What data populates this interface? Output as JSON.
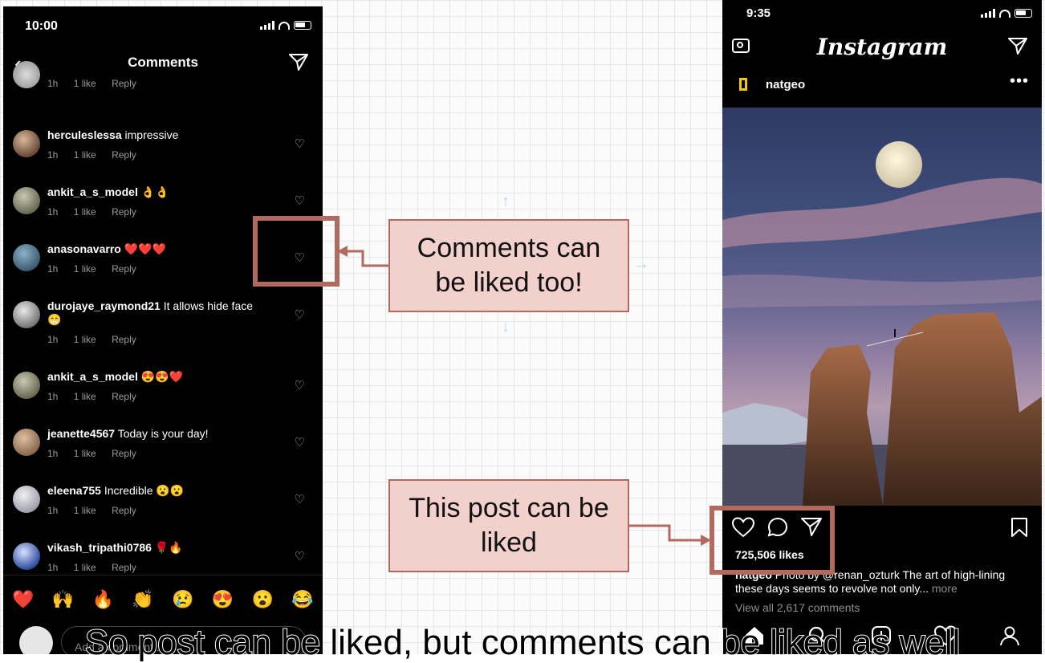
{
  "left_phone": {
    "status_time": "10:00",
    "nav_title": "Comments",
    "first_row_meta": {
      "time": "1h",
      "likes": "1 like",
      "reply": "Reply"
    },
    "comments": [
      {
        "user": "herculeslessa",
        "text": " impressive",
        "time": "1h",
        "likes": "1 like",
        "reply": "Reply"
      },
      {
        "user": "ankit_a_s_model",
        "text": " 👌👌",
        "time": "1h",
        "likes": "1 like",
        "reply": "Reply"
      },
      {
        "user": "anasonavarro",
        "text": " ❤️❤️❤️",
        "time": "1h",
        "likes": "1 like",
        "reply": "Reply"
      },
      {
        "user": "durojaye_raymond21",
        "text": " It allows hide face",
        "text2": "😁",
        "time": "1h",
        "likes": "1 like",
        "reply": "Reply"
      },
      {
        "user": "ankit_a_s_model",
        "text": " 😍😍❤️",
        "time": "1h",
        "likes": "1 like",
        "reply": "Reply"
      },
      {
        "user": "jeanette4567",
        "text": " Today is your day!",
        "time": "1h",
        "likes": "1 like",
        "reply": "Reply"
      },
      {
        "user": "eleena755",
        "text": " Incredible 😮😮",
        "time": "1h",
        "likes": "1 like",
        "reply": "Reply"
      },
      {
        "user": "vikash_tripathi0786",
        "text": " 🌹🔥",
        "time": "1h",
        "likes": "1 like",
        "reply": "Reply"
      }
    ],
    "emojis": [
      "❤️",
      "🙌",
      "🔥",
      "👏",
      "😢",
      "😍",
      "😮",
      "😂"
    ],
    "add_comment_placeholder": "Add a comment..."
  },
  "callouts": {
    "comments_like": "Comments can be liked too!",
    "post_like": "This post can be liked"
  },
  "right_phone": {
    "status_time": "9:35",
    "logo": "Instagram",
    "username": "natgeo",
    "more": "•••",
    "likes": "725,506 likes",
    "caption_user": "natgeo",
    "caption_text": " Photo by @renan_ozturk  The art of high-lining these days seems to revolve not only...",
    "caption_more": " more",
    "view_all": "View all 2,617 comments"
  },
  "subtitle": "So post can be liked, but comments can be liked as well",
  "colors": {
    "accent": "#b26a5e",
    "callout_fill": "#f2d0cb",
    "phone_bg": "#000000"
  }
}
